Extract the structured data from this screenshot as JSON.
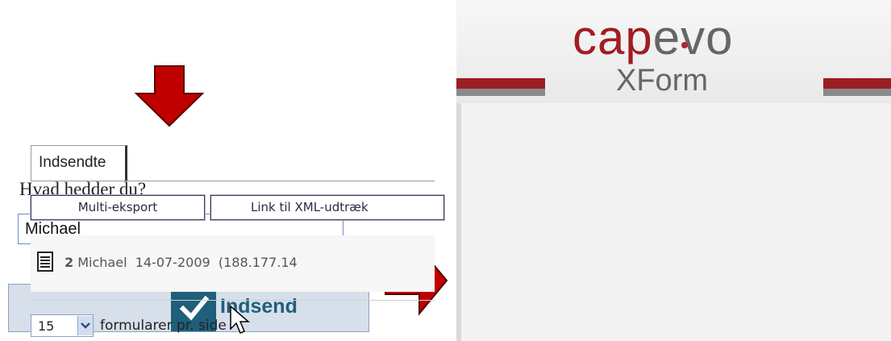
{
  "form": {
    "question": "Hvad hedder du?",
    "name_value": "Michael",
    "submit_label": "Indsend"
  },
  "app": {
    "logo": {
      "word": "capevo",
      "sub": "XForm"
    },
    "tab_label": "Indsendte",
    "toolbar": {
      "multi_export": "Multi-eksport",
      "xml_link": "Link til XML-udtræk"
    },
    "submissions": [
      {
        "number": "2",
        "name": "Michael",
        "date": "14-07-2009",
        "ip": "(188.177.14"
      }
    ],
    "per_page": {
      "value": "15",
      "label": "formularer pr. side"
    }
  },
  "colors": {
    "arrow_red": "#c00000",
    "brand_red": "#a11d23",
    "submit_blue": "#1f5f7a"
  },
  "icons": [
    "arrow-down-icon",
    "checkmark-icon",
    "mouse-cursor-icon",
    "arrow-right-icon",
    "document-icon",
    "chevron-down-icon"
  ]
}
